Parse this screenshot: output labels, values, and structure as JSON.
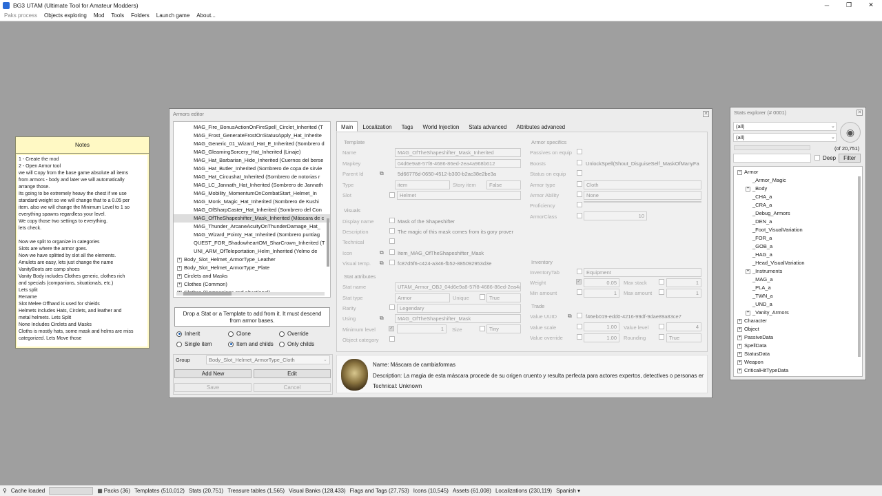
{
  "app": {
    "title": "BG3 UTAM (Ultimate Tool for Amateur Modders)"
  },
  "menu": [
    "Paks process",
    "Objects exploring",
    "Mod",
    "Tools",
    "Folders",
    "Launch game",
    "About..."
  ],
  "notes": {
    "title": "Notes",
    "lines": [
      "1 - Create the mod",
      "2 - Open Armor tool",
      "we will Copy from the base game absolute all items",
      "from armors - body and later we will automatically",
      "arrange those.",
      "Its going to be extremely heavy the chest if we use",
      "standard weight so we will change that to a 0.05 per",
      "item. also we will change the Minimum Level to 1 so",
      "everything spawns regardless your level.",
      "We copy those two settings to everything.",
      "lets check.",
      "",
      "Now we split to organize in categories",
      "Slots are where the armor goes.",
      "Now we have splitted by slot all the elements.",
      "Amulets are easy, lets just change the name",
      "VanityBoots are camp shoes",
      "Vanity Body includes Clothes generic, clothes rich",
      "and specials (companions, situationals, etc.)",
      "Lets split",
      "Rename",
      "Slot Melee Offhand is used for shields",
      "Helmets includes Hats, Circlets, and leather and",
      "metal helmets. Lets Split",
      "None Includes Circlets and Masks",
      "Cloths is mostly hats, some mask and helms are miss",
      "categorized. Lets Move those"
    ]
  },
  "armors_editor": {
    "title": "Armors editor",
    "tree": [
      "MAG_Fire_BonusActionOnFireSpell_Circlet_Inherited (T",
      "MAG_Frost_GenerateFrostOnStatusApply_Hat_Inherite",
      "MAG_Generic_01_Wizard_Hat_E_Inherited (Sombrero d",
      "MAG_GleamingSorcery_Hat_Inherited (Linaje)",
      "MAG_Hat_Barbarian_Hide_Inherited (Cuernos del berse",
      "MAG_Hat_Butler_Inherited (Sombrero de copa de sirvie",
      "MAG_Hat_Circushat_Inherited (Sombrero de notorias r",
      "MAG_LC_Jannath_Hat_Inherited (Sombrero de Jannath",
      "MAG_Mobility_MomentumOnCombatStart_Helmet_In",
      "MAG_Monk_Magic_Hat_Inherited (Sombrero de Kushi",
      "MAG_OfSharpCaster_Hat_Inherited (Sombrero del Con",
      "MAG_OfTheShapeshifter_Mask_Inherited (Máscara de c",
      "MAG_Thunder_ArcaneAcuityOnThunderDamage_Hat_",
      "MAG_Wizard_Pointy_Hat_Inherited (Sombrero puntiag",
      "QUEST_FOR_ShadowheartOM_SharCrown_Inherited (T",
      "UNI_ARM_OfTeleportation_Helm_Inherited (Yelmo de"
    ],
    "tree_groups": [
      "Body_Slot_Helmet_ArmorType_Leather",
      "Body_Slot_Helmet_ArmorType_Plate",
      "Circlets and Masks",
      "Clothes (Common)",
      "Clothes (Companions and situational)"
    ],
    "drop_hint": "Drop a Stat or a Template to add from it.  It must descend from armor bases.",
    "radios": {
      "inherit": "Inherit",
      "clone": "Clone",
      "override": "Override",
      "single": "Single item",
      "item_childs": "Item and childs",
      "only_childs": "Only childs"
    },
    "group_label": "Group",
    "group_value": "Body_Slot_Helmet_ArmorType_Cloth",
    "buttons": {
      "add_new": "Add New",
      "edit": "Edit",
      "save": "Save",
      "cancel": "Cancel"
    },
    "tabs": [
      "Main",
      "Localization",
      "Tags",
      "World Injection",
      "Stats advanced",
      "Attributes advanced"
    ],
    "template": {
      "title": "Template",
      "name_l": "Name",
      "name": "MAG_OfTheShapeshifter_Mask_Inherited",
      "mapkey_l": "Mapkey",
      "mapkey": "04d6e9a8-57f8-4686-86ed-2ea4a968b612",
      "parent_l": "Parent Id",
      "parent": "5d66776d-0650-4512-b300-b2ac38e2be3a",
      "type_l": "Type",
      "type": "item",
      "story_l": "Story item",
      "story": "False",
      "slot_l": "Slot",
      "slot": "Helmet"
    },
    "visuals": {
      "title": "Visuals",
      "display_l": "Display name",
      "display": "Mask of the Shapeshifter",
      "desc_l": "Description",
      "desc": "The magic of this mask comes from its gory prover",
      "tech_l": "Technical",
      "icon_l": "Icon",
      "icon": "Item_MAG_OfTheShapeshifter_Mask",
      "vt_l": "Visual temp.",
      "vt": "fc87d5f6-c424-a346-fb52-885092953d3e"
    },
    "stat": {
      "title": "Stat attributes",
      "statname_l": "Stat name",
      "statname": "UTAM_Armor_OBJ_04d6e9a8-57f8-4686-86ed-2ea4a",
      "stattype_l": "Stat type",
      "stattype": "Armor",
      "unique_l": "Unique",
      "unique": "True",
      "rarity_l": "Rarity",
      "rarity": "Legendary",
      "using_l": "Using",
      "using": "MAG_OfTheShapeshifter_Mask",
      "minlevel_l": "Minimum level",
      "minlevel": "1",
      "size_l": "Size",
      "size": "Tiny",
      "objcat_l": "Object category"
    },
    "armor_specifics": {
      "title": "Armor specifics",
      "passives_l": "Passives on equip",
      "boosts_l": "Boosts",
      "boosts": "UnlockSpell(Shout_DisguiseSelf_MaskOfManyFa",
      "status_l": "Status on equip",
      "armortype_l": "Armor type",
      "armortype": "Cloth",
      "ability_l": "Armor Ability",
      "ability": "None",
      "prof_l": "Proficiency",
      "ac_l": "ArmorClass",
      "ac": "10"
    },
    "inventory": {
      "title": "Inventory",
      "tab_l": "InventoryTab",
      "tab": "Equipment",
      "weight_l": "Weight",
      "weight": "0.05",
      "maxstack_l": "Max stack",
      "maxstack": "1",
      "minamount_l": "Min amount",
      "minamount": "1",
      "maxamount_l": "Max amount",
      "maxamount": "1"
    },
    "trade": {
      "title": "Trade",
      "uuid_l": "Value UUID",
      "uuid": "f46eb019-edd0-4216-99df-9dae89a83ce7",
      "scale_l": "Value scale",
      "scale": "1.00",
      "level_l": "Value level",
      "level": "4",
      "override_l": "Value override",
      "override": "1.00",
      "rounding_l": "Rounding",
      "rounding": "True"
    },
    "preview": {
      "name": "Name: Máscara de cambiaformas",
      "desc": "Description: La magia de esta máscara procede de su origen cruento y resulta perfecta para actores expertos, detectives o personas en ...",
      "tech": "Technical: Unknown"
    }
  },
  "stats_explorer": {
    "title": "Stats explorer (# 0001)",
    "filter1": "(all)",
    "filter2": "(all)",
    "count": "(of 20,751)",
    "deep": "Deep",
    "filter_btn": "Filter",
    "tree": [
      {
        "t": "Armor",
        "e": "−",
        "d": 0
      },
      {
        "t": "_Armor_Magic",
        "e": "",
        "d": 1
      },
      {
        "t": "_Body",
        "e": "+",
        "d": 1
      },
      {
        "t": "_CHA_a",
        "e": "",
        "d": 1
      },
      {
        "t": "_CRA_a",
        "e": "",
        "d": 1
      },
      {
        "t": "_Debug_Armors",
        "e": "",
        "d": 1
      },
      {
        "t": "_DEN_a",
        "e": "",
        "d": 1
      },
      {
        "t": "_Foot_VisualVariation",
        "e": "",
        "d": 1
      },
      {
        "t": "_FOR_a",
        "e": "",
        "d": 1
      },
      {
        "t": "_GOB_a",
        "e": "",
        "d": 1
      },
      {
        "t": "_HAG_a",
        "e": "",
        "d": 1
      },
      {
        "t": "_Head_VisualVariation",
        "e": "",
        "d": 1
      },
      {
        "t": "_Instruments",
        "e": "+",
        "d": 1
      },
      {
        "t": "_MAG_a",
        "e": "",
        "d": 1
      },
      {
        "t": "_PLA_a",
        "e": "",
        "d": 1
      },
      {
        "t": "_TWN_a",
        "e": "",
        "d": 1
      },
      {
        "t": "_UND_a",
        "e": "",
        "d": 1
      },
      {
        "t": "_Vanity_Armors",
        "e": "+",
        "d": 1
      },
      {
        "t": "Character",
        "e": "+",
        "d": 0
      },
      {
        "t": "Object",
        "e": "+",
        "d": 0
      },
      {
        "t": "PassiveData",
        "e": "+",
        "d": 0
      },
      {
        "t": "SpellData",
        "e": "+",
        "d": 0
      },
      {
        "t": "StatusData",
        "e": "+",
        "d": 0
      },
      {
        "t": "Weapon",
        "e": "+",
        "d": 0
      },
      {
        "t": "CriticalHitTypeData",
        "e": "+",
        "d": 0
      }
    ]
  },
  "status": [
    "Cache loaded",
    "Packs (36)",
    "Templates (510,012)",
    "Stats (20,751)",
    "Treasure tables (1,565)",
    "Visual Banks (128,433)",
    "Flags and Tags (27,753)",
    "Icons (10,545)",
    "Assets (61,008)",
    "Localizations (230,119)",
    "Spanish"
  ]
}
